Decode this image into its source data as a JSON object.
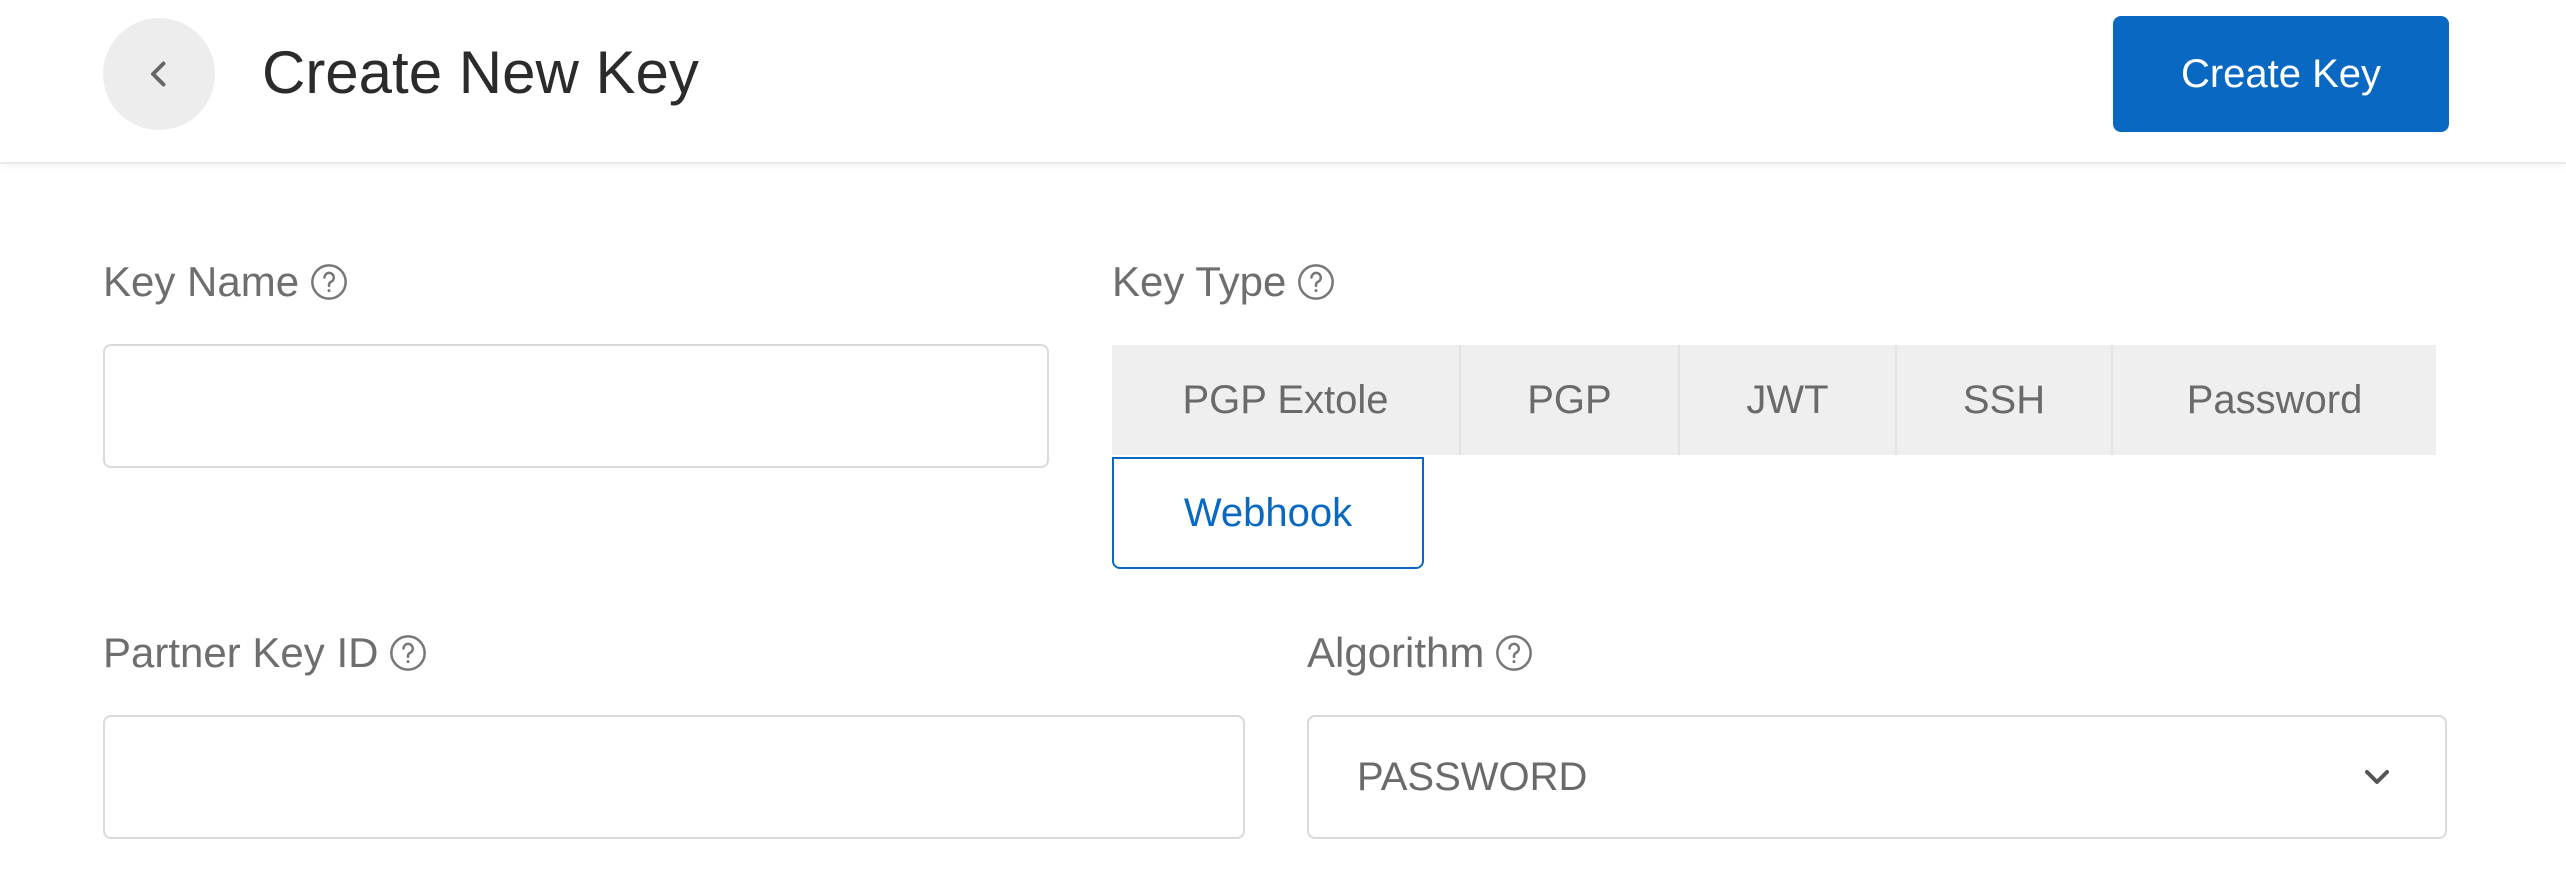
{
  "header": {
    "title": "Create New Key",
    "create_button_label": "Create Key"
  },
  "form": {
    "key_name": {
      "label": "Key Name",
      "value": ""
    },
    "key_type": {
      "label": "Key Type",
      "options": [
        "PGP Extole",
        "PGP",
        "JWT",
        "SSH",
        "Password"
      ],
      "selected": "Webhook"
    },
    "partner_key_id": {
      "label": "Partner Key ID",
      "value": ""
    },
    "algorithm": {
      "label": "Algorithm",
      "value": "PASSWORD"
    }
  },
  "icons": {
    "back": "chevron-left-icon",
    "help": "question-circle-icon",
    "dropdown": "chevron-down-icon"
  },
  "colors": {
    "accent": "#0969c2",
    "segment_bg": "#efefef",
    "border": "#dadada"
  }
}
